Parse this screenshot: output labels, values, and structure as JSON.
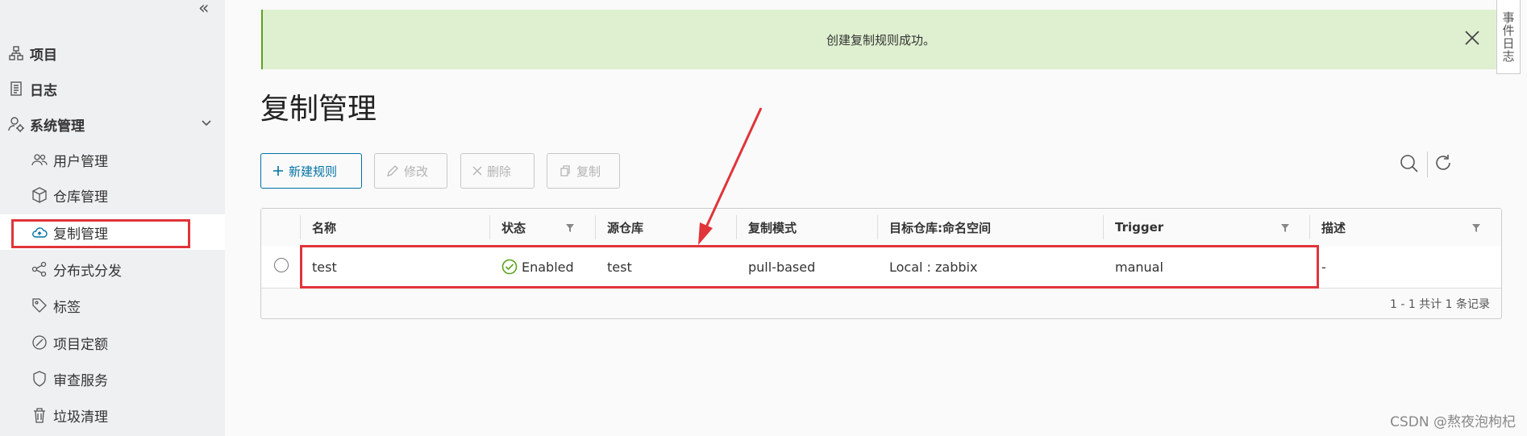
{
  "sidebar": {
    "collapse_icon": "double-chevron-left-icon",
    "items": [
      {
        "label": "项目",
        "icon": "project-icon",
        "level": "top"
      },
      {
        "label": "日志",
        "icon": "log-icon",
        "level": "top"
      },
      {
        "label": "系统管理",
        "icon": "admin-icon",
        "level": "top",
        "expanded": true
      },
      {
        "label": "用户管理",
        "icon": "users-icon",
        "level": "sub"
      },
      {
        "label": "仓库管理",
        "icon": "registry-icon",
        "level": "sub"
      },
      {
        "label": "复制管理",
        "icon": "cloud-replication-icon",
        "level": "sub",
        "active": true
      },
      {
        "label": "分布式分发",
        "icon": "share-icon",
        "level": "sub"
      },
      {
        "label": "标签",
        "icon": "tag-icon",
        "level": "sub"
      },
      {
        "label": "项目定额",
        "icon": "quota-icon",
        "level": "sub"
      },
      {
        "label": "审查服务",
        "icon": "shield-icon",
        "level": "sub"
      },
      {
        "label": "垃圾清理",
        "icon": "trash-icon",
        "level": "sub"
      }
    ]
  },
  "alert": {
    "message": "创建复制规则成功。",
    "color": "#dff0d0"
  },
  "page": {
    "title": "复制管理"
  },
  "toolbar": {
    "new_rule": "新建规则",
    "edit": "修改",
    "delete": "删除",
    "copy": "复制"
  },
  "table": {
    "columns": [
      "名称",
      "状态",
      "源仓库",
      "复制模式",
      "目标仓库:命名空间",
      "Trigger",
      "描述"
    ],
    "rows": [
      {
        "name": "test",
        "status": "Enabled",
        "source": "test",
        "mode": "pull-based",
        "target": "Local : zabbix",
        "trigger": "manual",
        "description": "-"
      }
    ],
    "footer": "1 - 1 共计 1 条记录"
  },
  "side_tab": {
    "label": "事件日志"
  },
  "watermark": "CSDN @熬夜泡枸杞",
  "colors": {
    "primary": "#0072a3",
    "highlight": "#e0343a",
    "success": "#5aa220",
    "sidebar_bg": "#eef0f2"
  }
}
